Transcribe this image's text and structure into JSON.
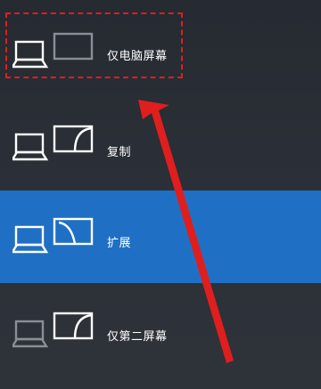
{
  "options": [
    {
      "id": "pc-screen-only",
      "label": "仅电脑屏幕",
      "selected": false
    },
    {
      "id": "duplicate",
      "label": "复制",
      "selected": false
    },
    {
      "id": "extend",
      "label": "扩展",
      "selected": true
    },
    {
      "id": "second-screen-only",
      "label": "仅第二屏幕",
      "selected": false
    }
  ],
  "colors": {
    "background": "#2d3036",
    "selected_background": "#1f70c4",
    "annotation": "#e01e1e",
    "active_icon": "#ffffff",
    "dim_icon": "#8a8e95"
  },
  "icons": {
    "laptop": "laptop-icon",
    "monitor": "monitor-icon",
    "annotation_arrow": "red-arrow-annotation"
  }
}
